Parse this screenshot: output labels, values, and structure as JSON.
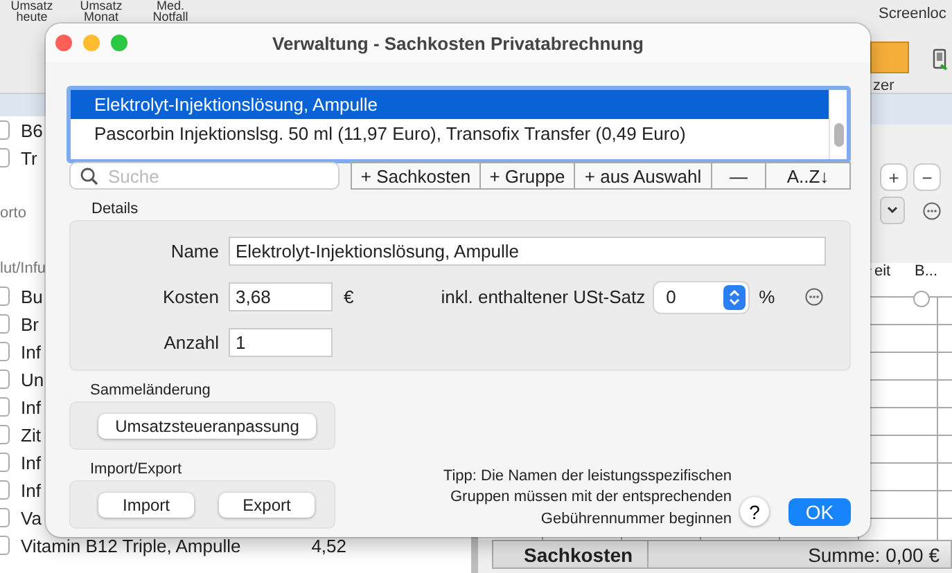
{
  "background_app": {
    "toolbar_items": [
      "Umsatz heute",
      "Umsatz Monat",
      "Med. Notfall"
    ],
    "screen_label": "Screenloc",
    "tool_label": "zer",
    "left_list": [
      {
        "kind": "row",
        "label": "B6",
        "checked": false
      },
      {
        "kind": "row",
        "label": "Tr",
        "checked": false
      },
      {
        "kind": "header",
        "label": "orto"
      },
      {
        "kind": "header",
        "label": "lut/Infu"
      },
      {
        "kind": "row",
        "label": "Bu",
        "checked": false
      },
      {
        "kind": "row",
        "label": "Br",
        "checked": false
      },
      {
        "kind": "row",
        "label": "Inf",
        "checked": false
      },
      {
        "kind": "row",
        "label": "Un",
        "checked": false
      },
      {
        "kind": "row",
        "label": "Inf",
        "checked": false
      },
      {
        "kind": "row",
        "label": "Zit",
        "checked": false
      },
      {
        "kind": "row",
        "label": "Inf",
        "checked": false
      },
      {
        "kind": "row",
        "label": "Inf",
        "checked": false
      },
      {
        "kind": "row",
        "label": "Va",
        "checked": false
      },
      {
        "kind": "row",
        "label": "Vitamin B12 Triple, Ampulle",
        "value": "4,52",
        "checked": false
      }
    ],
    "small_buttons": [
      "+",
      "−"
    ],
    "table_columns": [
      "eit",
      "B..."
    ],
    "status_tab": "Sachkosten",
    "status_sum": "Summe: 0,00 €"
  },
  "dialog": {
    "title": "Verwaltung - Sachkosten Privatabrechnung",
    "items": [
      {
        "label": "Elektrolyt-Injektionslösung, Ampulle",
        "selected": true
      },
      {
        "label": "Pascorbin Injektionslsg. 50 ml (11,97 Euro), Transofix Transfer (0,49 Euro)",
        "selected": false
      }
    ],
    "search": {
      "placeholder": "Suche"
    },
    "list_buttons": [
      "+ Sachkosten",
      "+ Gruppe",
      "+ aus Auswahl",
      "—",
      "A..Z↓"
    ],
    "details": {
      "title": "Details",
      "name_label": "Name",
      "name": "Elektrolyt-Injektionslösung, Ampulle",
      "cost_label": "Kosten",
      "cost": "3,68",
      "currency": "€",
      "vat_label": "inkl. enthaltener USt-Satz",
      "vat": "0",
      "percent": "%",
      "count_label": "Anzahl",
      "count": "1"
    },
    "bulk": {
      "title": "Sammeländerung",
      "button": "Umsatzsteueranpassung"
    },
    "import_export": {
      "title": "Import/Export",
      "buttons": [
        "Import",
        "Export"
      ]
    },
    "tip": "Tipp: Die Namen der leistungsspezifischen Gruppen müssen mit der entsprechenden Gebührennummer beginnen",
    "help": "?",
    "ok": "OK"
  }
}
